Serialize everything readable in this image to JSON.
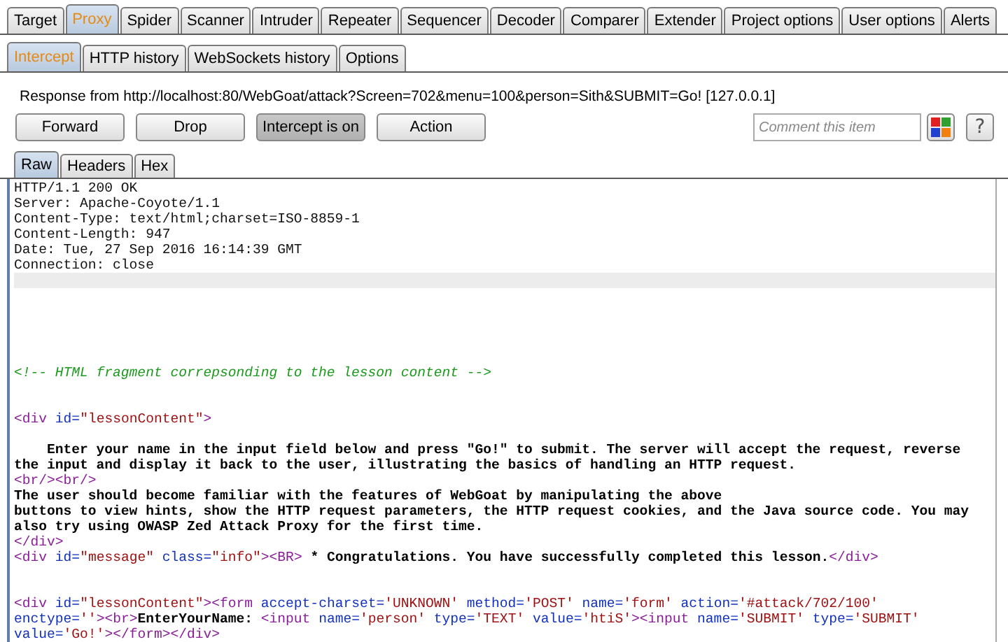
{
  "main_tabs": [
    {
      "label": "Target",
      "selected": false
    },
    {
      "label": "Proxy",
      "selected": true
    },
    {
      "label": "Spider",
      "selected": false
    },
    {
      "label": "Scanner",
      "selected": false
    },
    {
      "label": "Intruder",
      "selected": false
    },
    {
      "label": "Repeater",
      "selected": false
    },
    {
      "label": "Sequencer",
      "selected": false
    },
    {
      "label": "Decoder",
      "selected": false
    },
    {
      "label": "Comparer",
      "selected": false
    },
    {
      "label": "Extender",
      "selected": false
    },
    {
      "label": "Project options",
      "selected": false
    },
    {
      "label": "User options",
      "selected": false
    },
    {
      "label": "Alerts",
      "selected": false
    }
  ],
  "sub_tabs": [
    {
      "label": "Intercept",
      "selected": true
    },
    {
      "label": "HTTP history",
      "selected": false
    },
    {
      "label": "WebSockets history",
      "selected": false
    },
    {
      "label": "Options",
      "selected": false
    }
  ],
  "response_info": "Response from http://localhost:80/WebGoat/attack?Screen=702&menu=100&person=Sith&SUBMIT=Go!  [127.0.0.1]",
  "buttons": [
    {
      "label": "Forward",
      "on": false
    },
    {
      "label": "Drop",
      "on": false
    },
    {
      "label": "Intercept is on",
      "on": true
    },
    {
      "label": "Action",
      "on": false
    }
  ],
  "comment": {
    "placeholder": "Comment this item"
  },
  "help_button": "?",
  "view_tabs": [
    {
      "label": "Raw",
      "selected": true
    },
    {
      "label": "Headers",
      "selected": false
    },
    {
      "label": "Hex",
      "selected": false
    }
  ],
  "lines": [
    {
      "kind": "code",
      "tokens": [
        {
          "kind": "plain",
          "text": "HTTP/1.1 200 OK"
        }
      ]
    },
    {
      "kind": "code",
      "tokens": [
        {
          "kind": "plain",
          "text": "Server: Apache-Coyote/1.1"
        }
      ]
    },
    {
      "kind": "code",
      "tokens": [
        {
          "kind": "plain",
          "text": "Content-Type: text/html;charset=ISO-8859-1"
        }
      ]
    },
    {
      "kind": "code",
      "tokens": [
        {
          "kind": "plain",
          "text": "Content-Length: 947"
        }
      ]
    },
    {
      "kind": "code",
      "tokens": [
        {
          "kind": "plain",
          "text": "Date: Tue, 27 Sep 2016 16:14:39 GMT"
        }
      ]
    },
    {
      "kind": "code",
      "tokens": [
        {
          "kind": "plain",
          "text": "Connection: close"
        }
      ]
    },
    {
      "kind": "caret"
    },
    {
      "kind": "blank"
    },
    {
      "kind": "blank"
    },
    {
      "kind": "blank"
    },
    {
      "kind": "blank"
    },
    {
      "kind": "blank"
    },
    {
      "kind": "code",
      "tokens": [
        {
          "kind": "comment",
          "text": "<!-- HTML fragment correpsonding to the lesson content -->"
        }
      ]
    },
    {
      "kind": "blank"
    },
    {
      "kind": "blank"
    },
    {
      "kind": "code",
      "tokens": [
        {
          "kind": "tag",
          "text": "<div"
        },
        {
          "kind": "attr",
          "text": " id="
        },
        {
          "kind": "value",
          "text": "\"lessonContent\""
        },
        {
          "kind": "tag",
          "text": ">"
        }
      ]
    },
    {
      "kind": "blank"
    },
    {
      "kind": "code",
      "tokens": [
        {
          "kind": "text",
          "text": "    Enter your name in the input field below and press \"Go!\" to submit. The server will accept the request, reverse"
        }
      ]
    },
    {
      "kind": "code",
      "tokens": [
        {
          "kind": "text",
          "text": "the input and display it back to the user, illustrating the basics of handling an HTTP request."
        }
      ]
    },
    {
      "kind": "code",
      "tokens": [
        {
          "kind": "tag",
          "text": "<br/><br/>"
        }
      ]
    },
    {
      "kind": "code",
      "tokens": [
        {
          "kind": "text",
          "text": "The user should become familiar with the features of WebGoat by manipulating the above"
        }
      ]
    },
    {
      "kind": "code",
      "tokens": [
        {
          "kind": "text",
          "text": "buttons to view hints, show the HTTP request parameters, the HTTP request cookies, and the Java source code. You may"
        }
      ]
    },
    {
      "kind": "code",
      "tokens": [
        {
          "kind": "text",
          "text": "also try using OWASP Zed Attack Proxy for the first time."
        }
      ]
    },
    {
      "kind": "code",
      "tokens": [
        {
          "kind": "tag",
          "text": "</div>"
        }
      ]
    },
    {
      "kind": "code",
      "tokens": [
        {
          "kind": "tag",
          "text": "<div"
        },
        {
          "kind": "attr",
          "text": " id="
        },
        {
          "kind": "value",
          "text": "\"message\""
        },
        {
          "kind": "attr",
          "text": " class="
        },
        {
          "kind": "value",
          "text": "\"info\""
        },
        {
          "kind": "tag",
          "text": "><BR>"
        },
        {
          "kind": "text",
          "text": " * Congratulations. You have successfully completed this lesson."
        },
        {
          "kind": "tag",
          "text": "</div>"
        }
      ]
    },
    {
      "kind": "blank"
    },
    {
      "kind": "blank"
    },
    {
      "kind": "code",
      "tokens": [
        {
          "kind": "tag",
          "text": "<div"
        },
        {
          "kind": "attr",
          "text": " id="
        },
        {
          "kind": "value",
          "text": "\"lessonContent\""
        },
        {
          "kind": "tag",
          "text": "><form"
        },
        {
          "kind": "attr",
          "text": " accept-charset="
        },
        {
          "kind": "value",
          "text": "'UNKNOWN'"
        },
        {
          "kind": "attr",
          "text": " method="
        },
        {
          "kind": "value",
          "text": "'POST'"
        },
        {
          "kind": "attr",
          "text": " name="
        },
        {
          "kind": "value",
          "text": "'form'"
        },
        {
          "kind": "attr",
          "text": " action="
        },
        {
          "kind": "value",
          "text": "'#attack/702/100'"
        }
      ]
    },
    {
      "kind": "code",
      "tokens": [
        {
          "kind": "attr",
          "text": "enctype="
        },
        {
          "kind": "value",
          "text": "''"
        },
        {
          "kind": "tag",
          "text": "><br>"
        },
        {
          "kind": "text",
          "text": "EnterYourName: "
        },
        {
          "kind": "tag",
          "text": "<input"
        },
        {
          "kind": "attr",
          "text": " name="
        },
        {
          "kind": "value",
          "text": "'person'"
        },
        {
          "kind": "attr",
          "text": " type="
        },
        {
          "kind": "value",
          "text": "'TEXT'"
        },
        {
          "kind": "attr",
          "text": " value="
        },
        {
          "kind": "value",
          "text": "'htiS'"
        },
        {
          "kind": "tag",
          "text": "><input"
        },
        {
          "kind": "attr",
          "text": " name="
        },
        {
          "kind": "value",
          "text": "'SUBMIT'"
        },
        {
          "kind": "attr",
          "text": " type="
        },
        {
          "kind": "value",
          "text": "'SUBMIT'"
        }
      ]
    },
    {
      "kind": "code",
      "tokens": [
        {
          "kind": "attr",
          "text": "value="
        },
        {
          "kind": "value",
          "text": "'Go!'"
        },
        {
          "kind": "tag",
          "text": "></form></div>"
        }
      ]
    }
  ]
}
